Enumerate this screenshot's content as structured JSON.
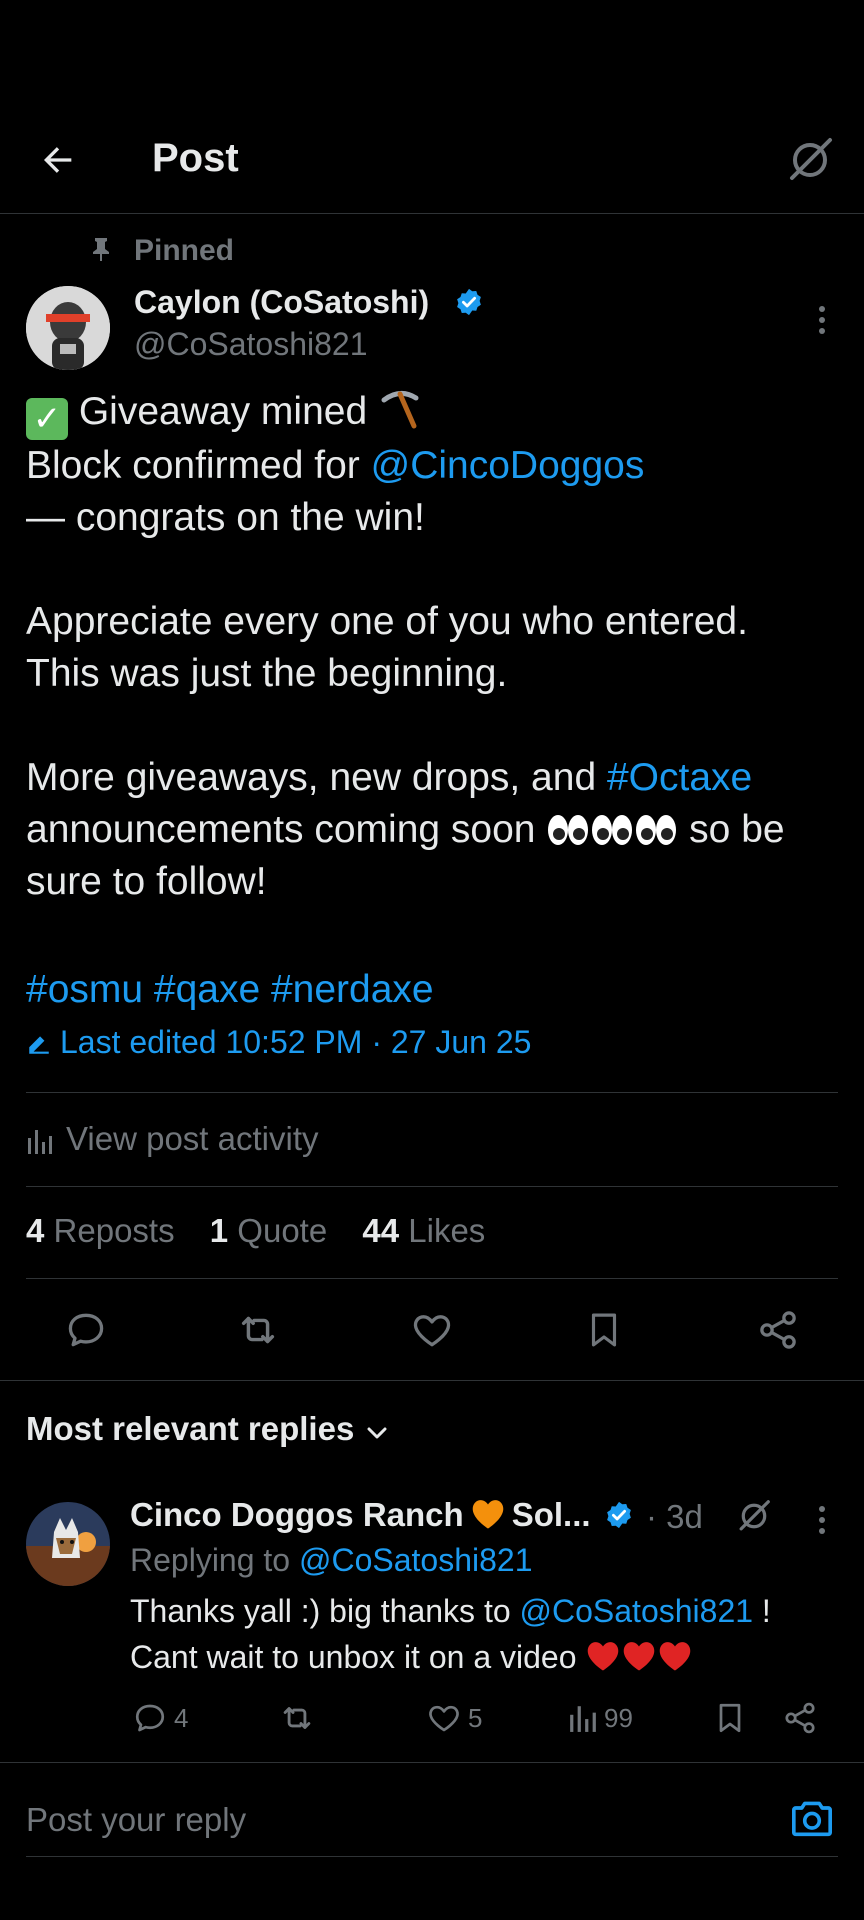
{
  "header": {
    "title": "Post"
  },
  "post": {
    "pinned_label": "Pinned",
    "author_name": "Caylon (CoSatoshi)",
    "author_handle": "@CoSatoshi821",
    "lines": {
      "l1_text": "Giveaway mined",
      "l2_prefix": "Block confirmed for ",
      "l2_mention": "@CincoDoggos",
      "l3": "— congrats on the win!",
      "l5": "Appreciate every one of you who entered.",
      "l6": "This was just the beginning.",
      "l8_prefix": "More giveaways, new drops, and ",
      "l8_hashtag": "#Octaxe",
      "l9_prefix": "announcements coming soon ",
      "l9_suffix": " so be",
      "l10": "sure to follow!",
      "hashtags": "#osmu #qaxe #nerdaxe"
    },
    "edited_label": "Last edited 10:52 PM · 27 Jun 25",
    "view_activity_label": "View post activity",
    "stats": {
      "reposts_count": "4",
      "reposts_label": "Reposts",
      "quotes_count": "1",
      "quotes_label": "Quote",
      "likes_count": "44",
      "likes_label": "Likes"
    }
  },
  "replies": {
    "header_label": "Most relevant replies",
    "items": [
      {
        "name_part1": "Cinco Doggos Ranch",
        "name_part2": "Sol...",
        "time": "· 3d",
        "replying_prefix": "Replying to ",
        "replying_handle": "@CoSatoshi821",
        "body_prefix": "Thanks yall :) big thanks to ",
        "body_mention": "@CoSatoshi821",
        "body_suffix": " !",
        "body_line2": "Cant wait to unbox it on a video",
        "reply_count": "4",
        "like_count": "5",
        "view_count": "99"
      }
    ]
  },
  "composer": {
    "placeholder": "Post your reply"
  },
  "colors": {
    "accent": "#1d9bf0",
    "muted": "#71767b",
    "text": "#e7e9ea",
    "border": "#2f3336",
    "background": "#000000"
  },
  "icons": [
    "back-arrow-icon",
    "grok-icon",
    "pin-icon",
    "verified-badge-icon",
    "more-icon",
    "pickaxe-icon",
    "check-mark-emoji-icon",
    "eyes-emoji-icon",
    "edit-icon",
    "analytics-icon",
    "reply-icon",
    "repost-icon",
    "like-icon",
    "bookmark-icon",
    "share-icon",
    "chevron-down-icon",
    "orange-heart-emoji-icon",
    "red-heart-emoji-icon",
    "camera-icon"
  ]
}
